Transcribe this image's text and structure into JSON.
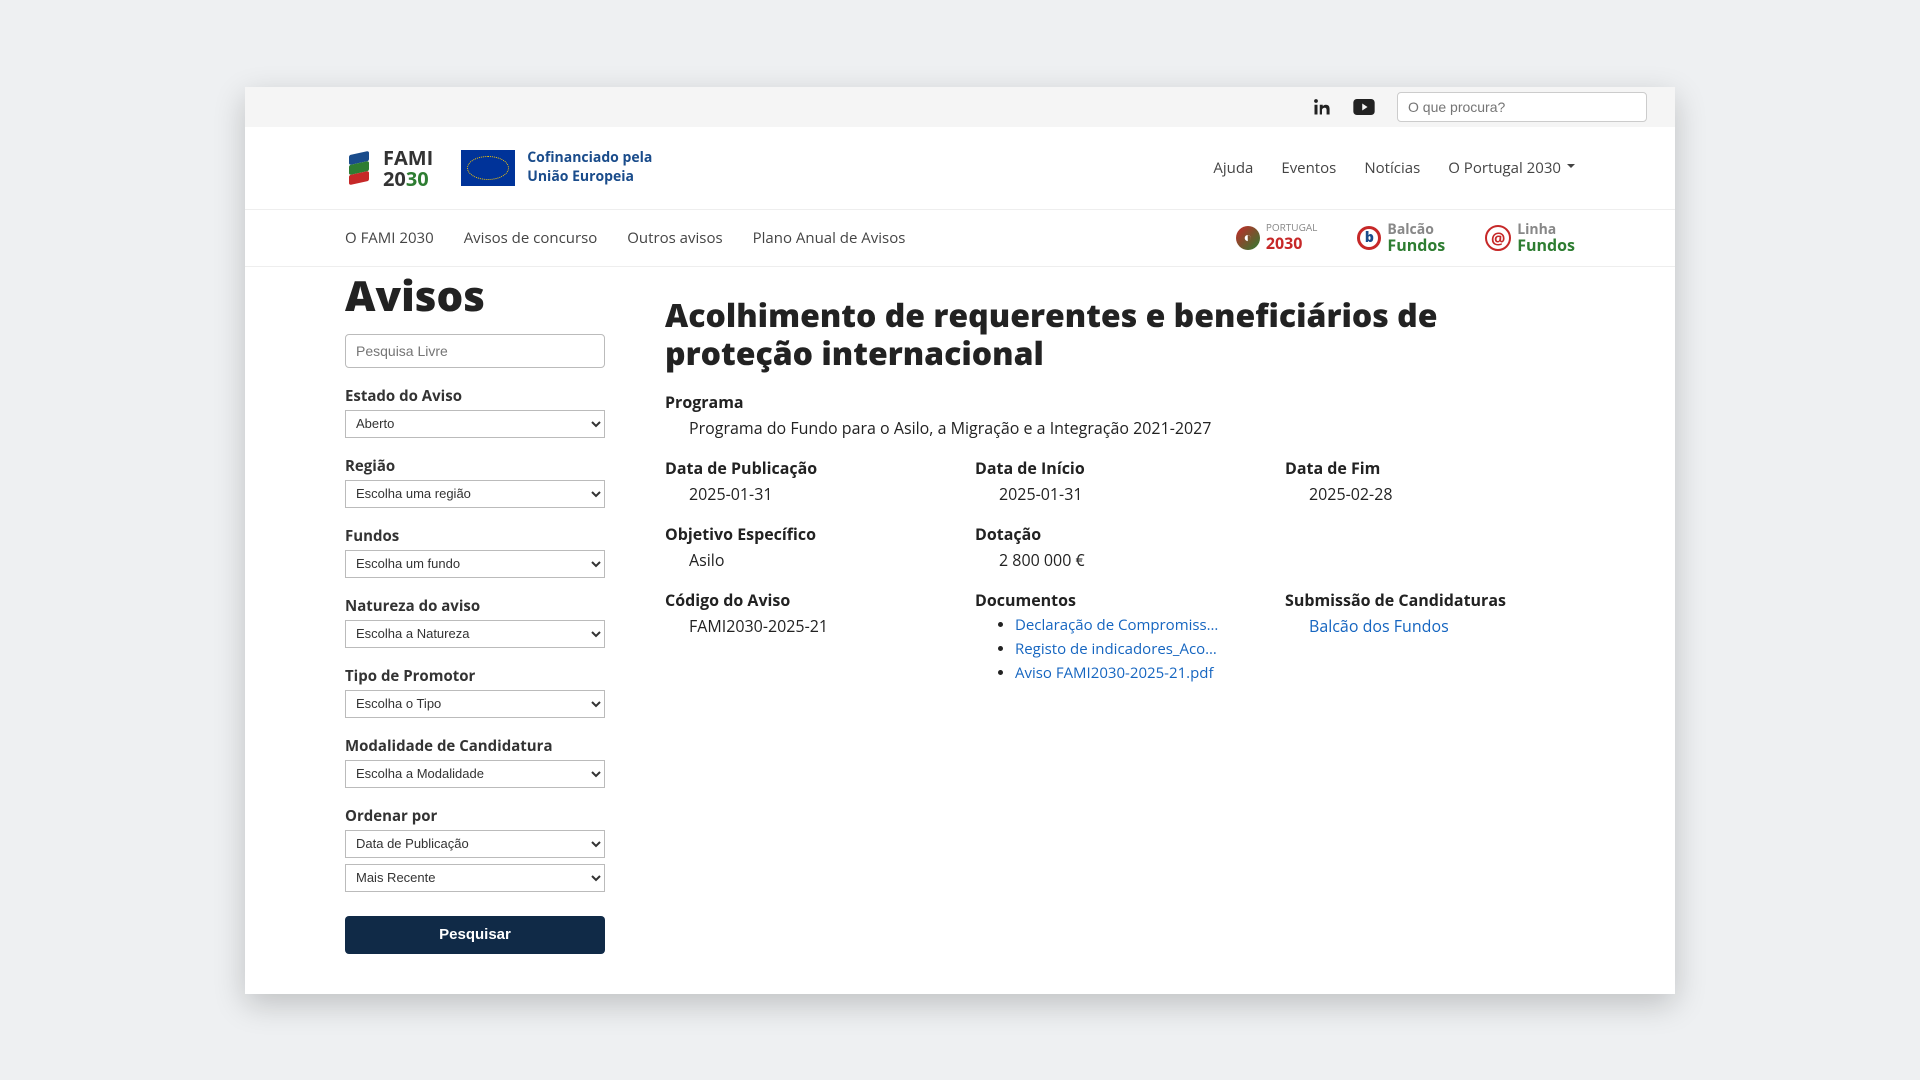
{
  "top": {
    "search_placeholder": "O que procura?"
  },
  "header": {
    "fami_l1": "FAMI",
    "fami_l2a": "20",
    "fami_l2b": "30",
    "eu_l1": "Cofinanciado pela",
    "eu_l2": "União Europeia",
    "nav": {
      "ajuda": "Ajuda",
      "eventos": "Eventos",
      "noticias": "Notícias",
      "portugal2030": "O Portugal 2030"
    }
  },
  "subnav": {
    "ofami": "O FAMI 2030",
    "avisos": "Avisos de concurso",
    "outros": "Outros avisos",
    "plano": "Plano Anual de Avisos"
  },
  "partners": {
    "p2030_sub": "PORTUGAL",
    "p2030": "2030",
    "balcao_t1": "Balcão",
    "balcao_t2": "Fundos",
    "linha_t1": "Linha",
    "linha_t2": "Fundos"
  },
  "sidebar": {
    "title": "Avisos",
    "free_search_placeholder": "Pesquisa Livre",
    "filters": {
      "estado": {
        "label": "Estado do Aviso",
        "value": "Aberto"
      },
      "regiao": {
        "label": "Região",
        "value": "Escolha uma região"
      },
      "fundos": {
        "label": "Fundos",
        "value": "Escolha um fundo"
      },
      "natureza": {
        "label": "Natureza do aviso",
        "value": "Escolha a Natureza"
      },
      "promotor": {
        "label": "Tipo de Promotor",
        "value": "Escolha o Tipo"
      },
      "modalidade": {
        "label": "Modalidade de Candidatura",
        "value": "Escolha a Modalidade"
      },
      "ordenar": {
        "label": "Ordenar por",
        "value1": "Data de Publicação",
        "value2": "Mais Recente"
      }
    },
    "search_btn": "Pesquisar"
  },
  "detail": {
    "title": "Acolhimento de requerentes e beneficiários de proteção internacional",
    "programa_lbl": "Programa",
    "programa_val": "Programa do Fundo para o Asilo, a Migração e a Integração 2021-2027",
    "data_pub_lbl": "Data de Publicação",
    "data_pub_val": "2025-01-31",
    "data_ini_lbl": "Data de Início",
    "data_ini_val": "2025-01-31",
    "data_fim_lbl": "Data de Fim",
    "data_fim_val": "2025-02-28",
    "obj_lbl": "Objetivo Específico",
    "obj_val": "Asilo",
    "dot_lbl": "Dotação",
    "dot_val": "2 800 000 €",
    "cod_lbl": "Código do Aviso",
    "cod_val": "FAMI2030-2025-21",
    "doc_lbl": "Documentos",
    "docs": {
      "d1": "Declaração de Compromiss…",
      "d2": "Registo de indicadores_Aco…",
      "d3": "Aviso FAMI2030-2025-21.pdf"
    },
    "sub_lbl": "Submissão de Candidaturas",
    "sub_link": "Balcão dos Fundos"
  }
}
